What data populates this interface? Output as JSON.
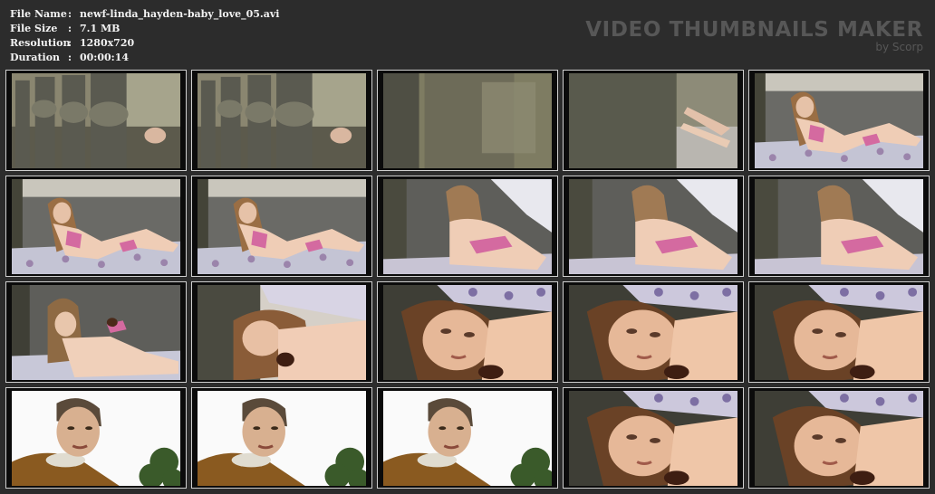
{
  "info": [
    {
      "key": "File Name",
      "value": "newf-linda_hayden-baby_love_05.avi"
    },
    {
      "key": "File Size",
      "value": "7.1 MB"
    },
    {
      "key": "Resolution",
      "value": "1280x720"
    },
    {
      "key": "Duration",
      "value": "00:00:14"
    }
  ],
  "separator": ":",
  "brand": {
    "title": "VIDEO THUMBNAILS MAKER",
    "subtitle": "by Scorp"
  },
  "thumbnails": [
    {
      "scene": "balustrade"
    },
    {
      "scene": "balustrade"
    },
    {
      "scene": "wall-blur"
    },
    {
      "scene": "wall-legs"
    },
    {
      "scene": "girl-far"
    },
    {
      "scene": "girl-far"
    },
    {
      "scene": "girl-far"
    },
    {
      "scene": "girl-back"
    },
    {
      "scene": "girl-back"
    },
    {
      "scene": "girl-back"
    },
    {
      "scene": "girl-mid"
    },
    {
      "scene": "girl-close"
    },
    {
      "scene": "face"
    },
    {
      "scene": "face"
    },
    {
      "scene": "face"
    },
    {
      "scene": "boy"
    },
    {
      "scene": "boy"
    },
    {
      "scene": "boy"
    },
    {
      "scene": "face"
    },
    {
      "scene": "face"
    }
  ]
}
